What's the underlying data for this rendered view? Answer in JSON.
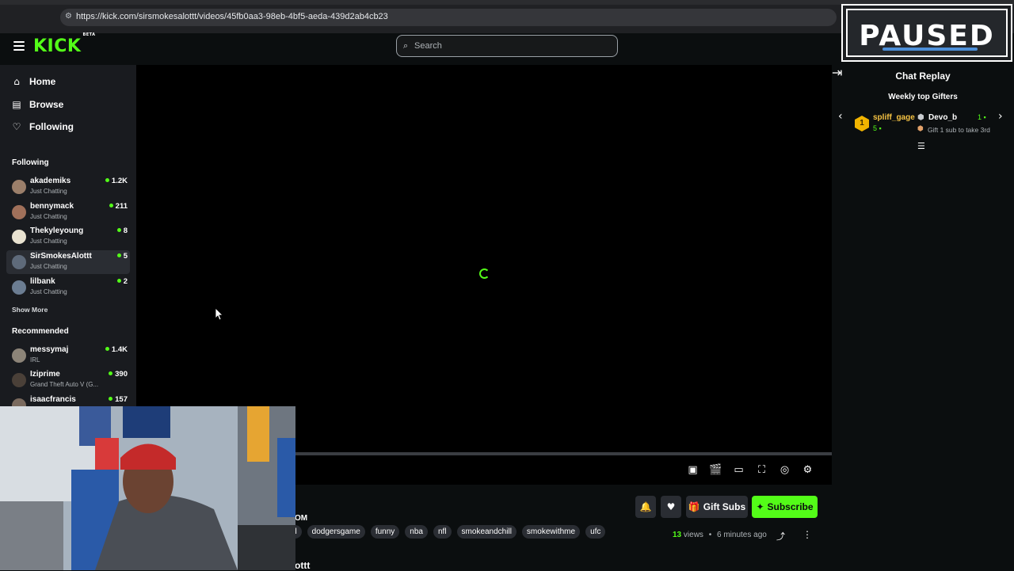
{
  "browser": {
    "url": "https://kick.com/sirsmokesalottt/videos/45fb0aa3-98eb-4bf5-aeda-439d2ab4cb23"
  },
  "header": {
    "logo": "KICK",
    "logo_badge": "BETA",
    "search_placeholder": "Search"
  },
  "sidebar": {
    "nav": [
      {
        "label": "Home",
        "icon": "home-icon"
      },
      {
        "label": "Browse",
        "icon": "browse-icon"
      },
      {
        "label": "Following",
        "icon": "heart-icon"
      }
    ],
    "following_heading": "Following",
    "following": [
      {
        "name": "akademiks",
        "category": "Just Chatting",
        "viewers": "1.2K"
      },
      {
        "name": "bennymack",
        "category": "Just Chatting",
        "viewers": "211"
      },
      {
        "name": "Thekyleyoung",
        "category": "Just Chatting",
        "viewers": "8"
      },
      {
        "name": "SirSmokesAlottt",
        "category": "Just Chatting",
        "viewers": "5"
      },
      {
        "name": "lilbank",
        "category": "Just Chatting",
        "viewers": "2"
      }
    ],
    "show_more": "Show More",
    "recommended_heading": "Recommended",
    "recommended": [
      {
        "name": "messymaj",
        "category": "IRL",
        "viewers": "1.4K"
      },
      {
        "name": "Iziprime",
        "category": "Grand Theft Auto V (G...",
        "viewers": "390"
      },
      {
        "name": "isaacfrancis",
        "category": "",
        "viewers": "157"
      }
    ]
  },
  "player": {
    "loading": true
  },
  "video_info": {
    "gift_subs_label": "Gift Subs",
    "subscribe_label": "Subscribe",
    "tags": [
      "ill",
      "dodgersgame",
      "funny",
      "nba",
      "nfl",
      "smokeandchill",
      "smokewithme",
      "ufc"
    ],
    "views_count": "13",
    "views_label": "views",
    "time_ago": "6 minutes ago",
    "partial_text_1": "OM",
    "partial_text_2": "ottt"
  },
  "chat": {
    "title": "Chat Replay",
    "gifters_heading": "Weekly top Gifters",
    "gifters": [
      {
        "rank": "1",
        "name": "spliff_gage",
        "count": "5"
      },
      {
        "name": "Devo_b",
        "count": "1"
      }
    ],
    "gift_prompt": "Gift 1 sub to take 3rd"
  },
  "overlay": {
    "paused_text": "PAUSED"
  },
  "colors": {
    "brand": "#53fc18",
    "background": "#0b0e0f",
    "sidebar": "#191b1f",
    "gold": "#f6c343"
  }
}
